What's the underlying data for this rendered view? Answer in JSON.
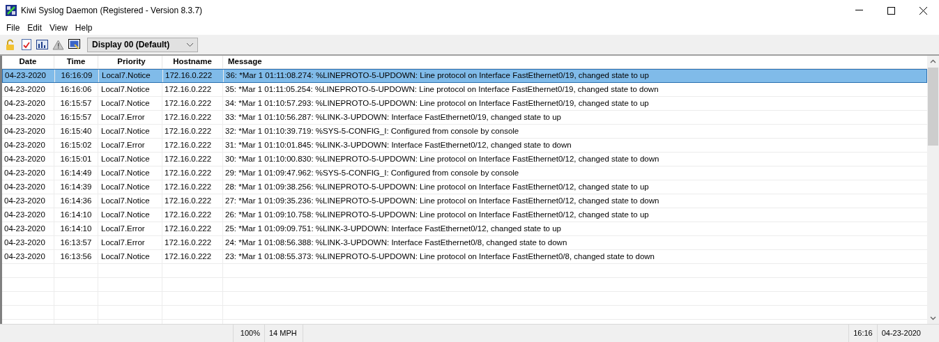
{
  "window": {
    "title": "Kiwi Syslog Daemon (Registered - Version 8.3.7)"
  },
  "menu": [
    "File",
    "Edit",
    "View",
    "Help"
  ],
  "toolbar": {
    "display_select": "Display 00 (Default)"
  },
  "table": {
    "columns": [
      "Date",
      "Time",
      "Priority",
      "Hostname",
      "Message"
    ],
    "rows": [
      {
        "selected": true,
        "cells": [
          "04-23-2020",
          "16:16:09",
          "Local7.Notice",
          "172.16.0.222",
          "36: *Mar  1 01:11:08.274: %LINEPROTO-5-UPDOWN: Line protocol on Interface FastEthernet0/19, changed state to up"
        ]
      },
      {
        "selected": false,
        "cells": [
          "04-23-2020",
          "16:16:06",
          "Local7.Notice",
          "172.16.0.222",
          "35: *Mar  1 01:11:05.254: %LINEPROTO-5-UPDOWN: Line protocol on Interface FastEthernet0/19, changed state to down"
        ]
      },
      {
        "selected": false,
        "cells": [
          "04-23-2020",
          "16:15:57",
          "Local7.Notice",
          "172.16.0.222",
          "34: *Mar  1 01:10:57.293: %LINEPROTO-5-UPDOWN: Line protocol on Interface FastEthernet0/19, changed state to up"
        ]
      },
      {
        "selected": false,
        "cells": [
          "04-23-2020",
          "16:15:57",
          "Local7.Error",
          "172.16.0.222",
          "33: *Mar  1 01:10:56.287: %LINK-3-UPDOWN: Interface FastEthernet0/19, changed state to up"
        ]
      },
      {
        "selected": false,
        "cells": [
          "04-23-2020",
          "16:15:40",
          "Local7.Notice",
          "172.16.0.222",
          "32: *Mar  1 01:10:39.719: %SYS-5-CONFIG_I: Configured from console by console"
        ]
      },
      {
        "selected": false,
        "cells": [
          "04-23-2020",
          "16:15:02",
          "Local7.Error",
          "172.16.0.222",
          "31: *Mar  1 01:10:01.845: %LINK-3-UPDOWN: Interface FastEthernet0/12, changed state to down"
        ]
      },
      {
        "selected": false,
        "cells": [
          "04-23-2020",
          "16:15:01",
          "Local7.Notice",
          "172.16.0.222",
          "30: *Mar  1 01:10:00.830: %LINEPROTO-5-UPDOWN: Line protocol on Interface FastEthernet0/12, changed state to down"
        ]
      },
      {
        "selected": false,
        "cells": [
          "04-23-2020",
          "16:14:49",
          "Local7.Notice",
          "172.16.0.222",
          "29: *Mar  1 01:09:47.962: %SYS-5-CONFIG_I: Configured from console by console"
        ]
      },
      {
        "selected": false,
        "cells": [
          "04-23-2020",
          "16:14:39",
          "Local7.Notice",
          "172.16.0.222",
          "28: *Mar  1 01:09:38.256: %LINEPROTO-5-UPDOWN: Line protocol on Interface FastEthernet0/12, changed state to up"
        ]
      },
      {
        "selected": false,
        "cells": [
          "04-23-2020",
          "16:14:36",
          "Local7.Notice",
          "172.16.0.222",
          "27: *Mar  1 01:09:35.236: %LINEPROTO-5-UPDOWN: Line protocol on Interface FastEthernet0/12, changed state to down"
        ]
      },
      {
        "selected": false,
        "cells": [
          "04-23-2020",
          "16:14:10",
          "Local7.Notice",
          "172.16.0.222",
          "26: *Mar  1 01:09:10.758: %LINEPROTO-5-UPDOWN: Line protocol on Interface FastEthernet0/12, changed state to up"
        ]
      },
      {
        "selected": false,
        "cells": [
          "04-23-2020",
          "16:14:10",
          "Local7.Error",
          "172.16.0.222",
          "25: *Mar  1 01:09:09.751: %LINK-3-UPDOWN: Interface FastEthernet0/12, changed state to up"
        ]
      },
      {
        "selected": false,
        "cells": [
          "04-23-2020",
          "16:13:57",
          "Local7.Error",
          "172.16.0.222",
          "24: *Mar  1 01:08:56.388: %LINK-3-UPDOWN: Interface FastEthernet0/8, changed state to down"
        ]
      },
      {
        "selected": false,
        "cells": [
          "04-23-2020",
          "16:13:56",
          "Local7.Notice",
          "172.16.0.222",
          "23: *Mar  1 01:08:55.373: %LINEPROTO-5-UPDOWN: Line protocol on Interface FastEthernet0/8, changed state to down"
        ]
      }
    ]
  },
  "status_bar": {
    "zoom": "100%",
    "speed": "14 MPH",
    "time": "16:16",
    "date": "04-23-2020"
  }
}
